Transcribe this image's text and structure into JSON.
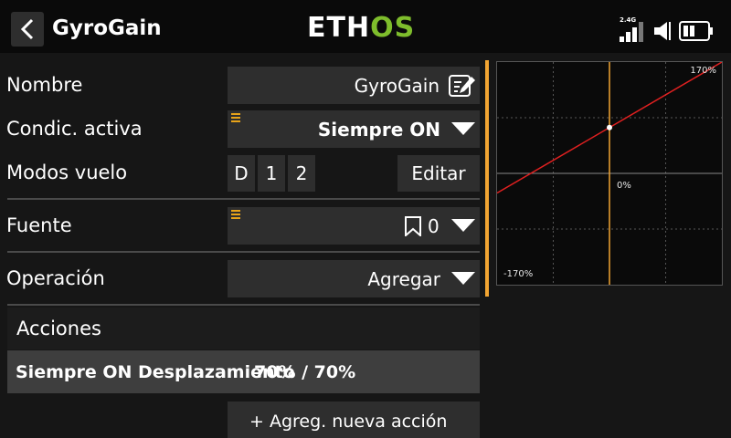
{
  "header": {
    "title": "GyroGain",
    "logo_part1": "ETH",
    "logo_part2": "OS",
    "rf_label": "2.4G",
    "accent_color": "#7ebd2c"
  },
  "form": {
    "nombre": {
      "label": "Nombre",
      "value": "GyroGain",
      "icon": "edit-icon"
    },
    "condicion": {
      "label": "Condic. activa",
      "value": "Siempre ON",
      "icon": "chevron-down-icon"
    },
    "modos": {
      "label": "Modos vuelo",
      "modes": [
        "D",
        "1",
        "2"
      ],
      "edit_label": "Editar"
    },
    "fuente": {
      "label": "Fuente",
      "value": "0",
      "icon": "bookmark-icon"
    },
    "operacion": {
      "label": "Operación",
      "value": "Agregar",
      "icon": "chevron-down-icon"
    }
  },
  "acciones": {
    "title": "Acciones",
    "items": [
      {
        "text": "Siempre ON Desplazamiento",
        "value": "70% / 70%"
      }
    ],
    "add_label": "+ Agreg. nueva acción"
  },
  "graph": {
    "max_label": "170%",
    "mid_label": "0%",
    "min_label": "-170%",
    "x_range": [
      -100,
      100
    ],
    "y_range": [
      -170,
      170
    ],
    "line_start": [
      -100,
      -30
    ],
    "line_end": [
      100,
      170
    ],
    "point": [
      0,
      70
    ],
    "line_color": "#e02020",
    "cursor_color": "#f2a532"
  }
}
